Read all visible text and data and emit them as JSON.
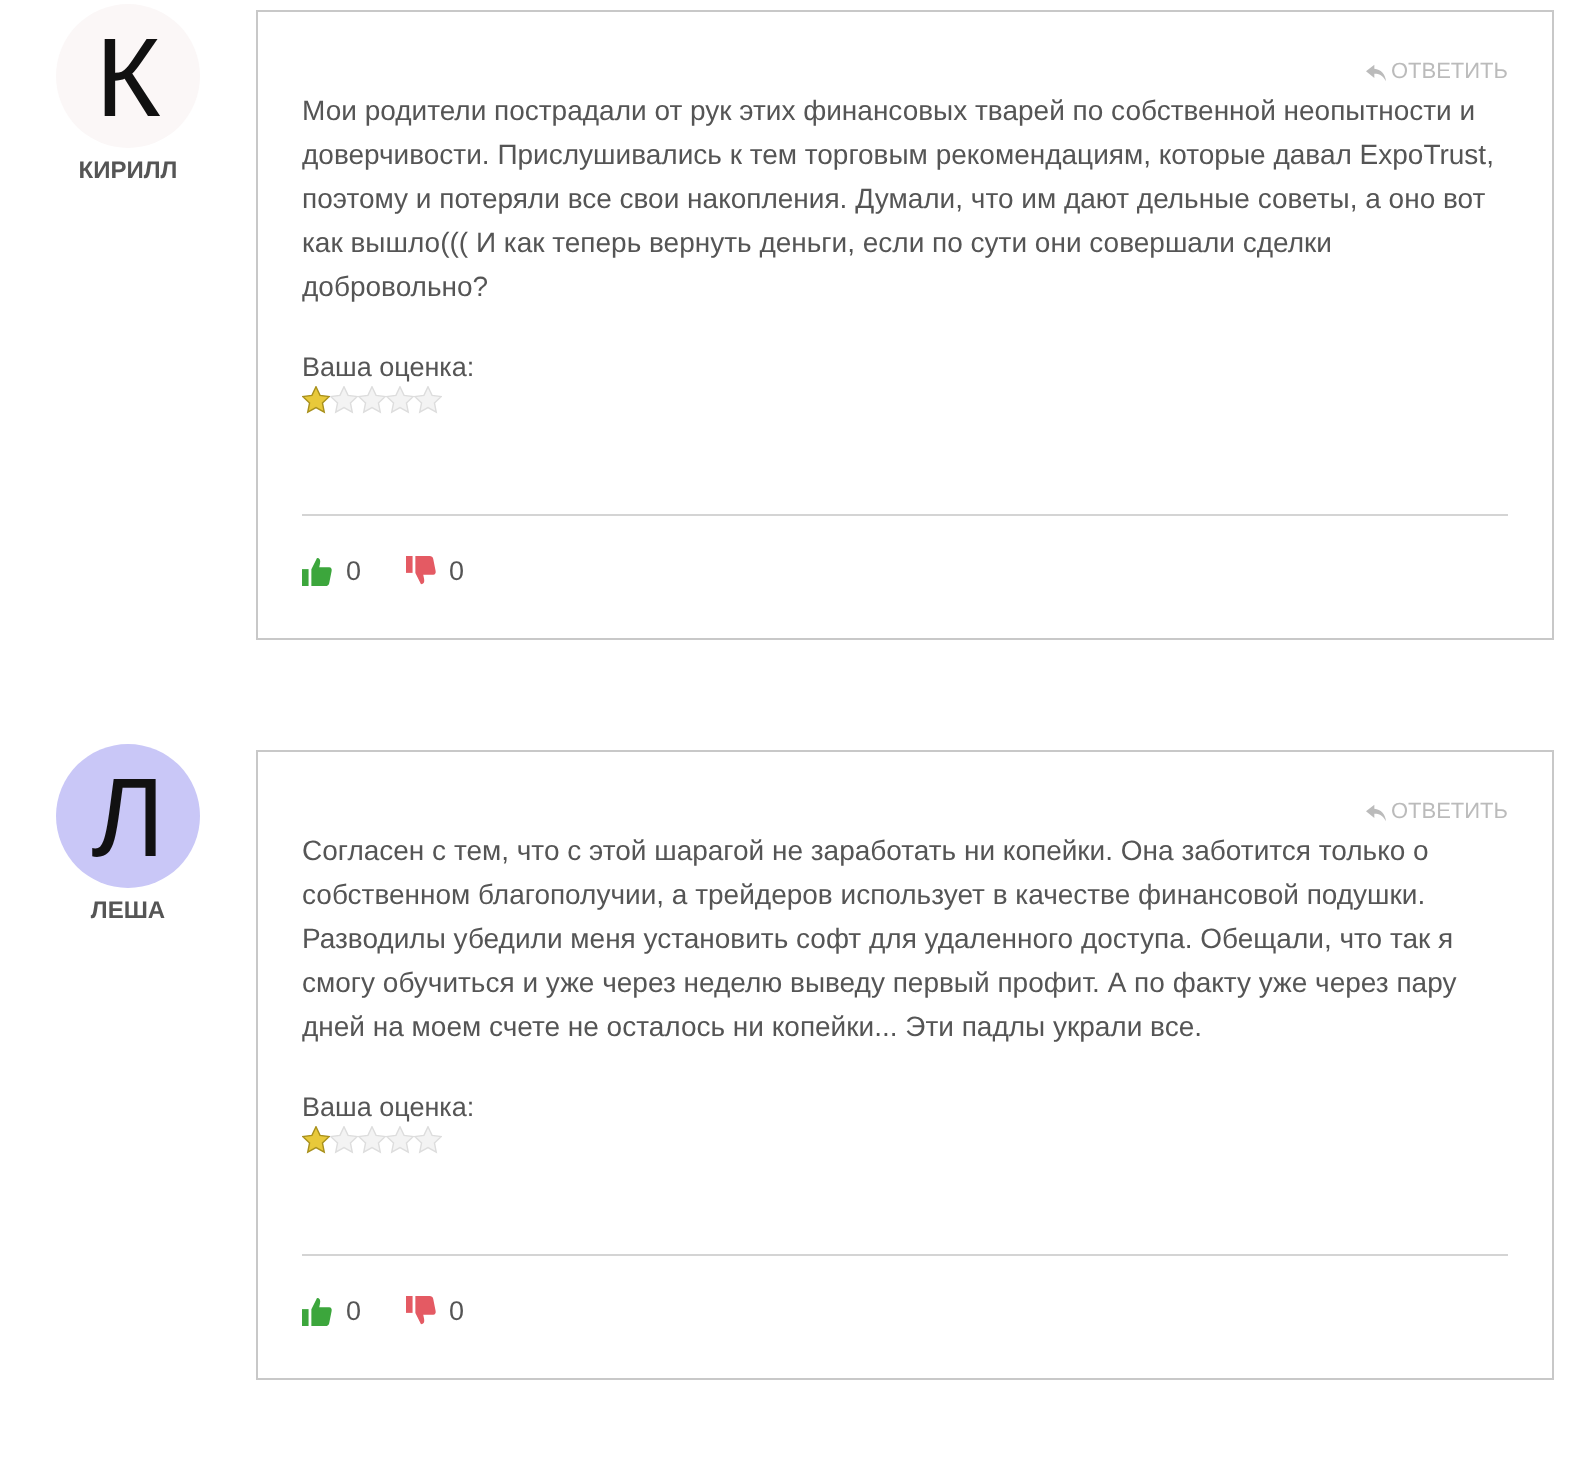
{
  "comments": [
    {
      "author": "КИРИЛЛ",
      "initial": "К",
      "color": "#fbf7f7",
      "reply": "ОТВЕТИТЬ",
      "text": "Мои родители пострадали от рук этих финансовых тварей по собственной неопытности и доверчивости. Прислушивались к тем торговым рекомендациям, которые давал ExpoTrust, поэтому и потеряли все свои накопления. Думали, что им дают дельные советы, а оно вот как вышло((( И как теперь вернуть деньги, если по сути они совершали сделки добровольно?",
      "rating_label": "Ваша оценка:",
      "stars": 1,
      "likes": "0",
      "dislikes": "0"
    },
    {
      "author": "ЛЕША",
      "initial": "Л",
      "color": "#c9c7f7",
      "reply": "ОТВЕТИТЬ",
      "text": "Согласен с тем, что с этой шарагой не заработать ни копейки. Она заботится только о собственном благополучии, а трейдеров использует в качестве финансовой подушки. Разводилы убедили меня установить софт для удаленного доступа. Обещали, что так я смогу обучиться и уже через неделю выведу первый профит. А по факту уже через пару дней на моем счете не осталось ни копейки... Эти падлы украли все.",
      "rating_label": "Ваша оценка:",
      "stars": 1,
      "likes": "0",
      "dislikes": "0"
    }
  ]
}
